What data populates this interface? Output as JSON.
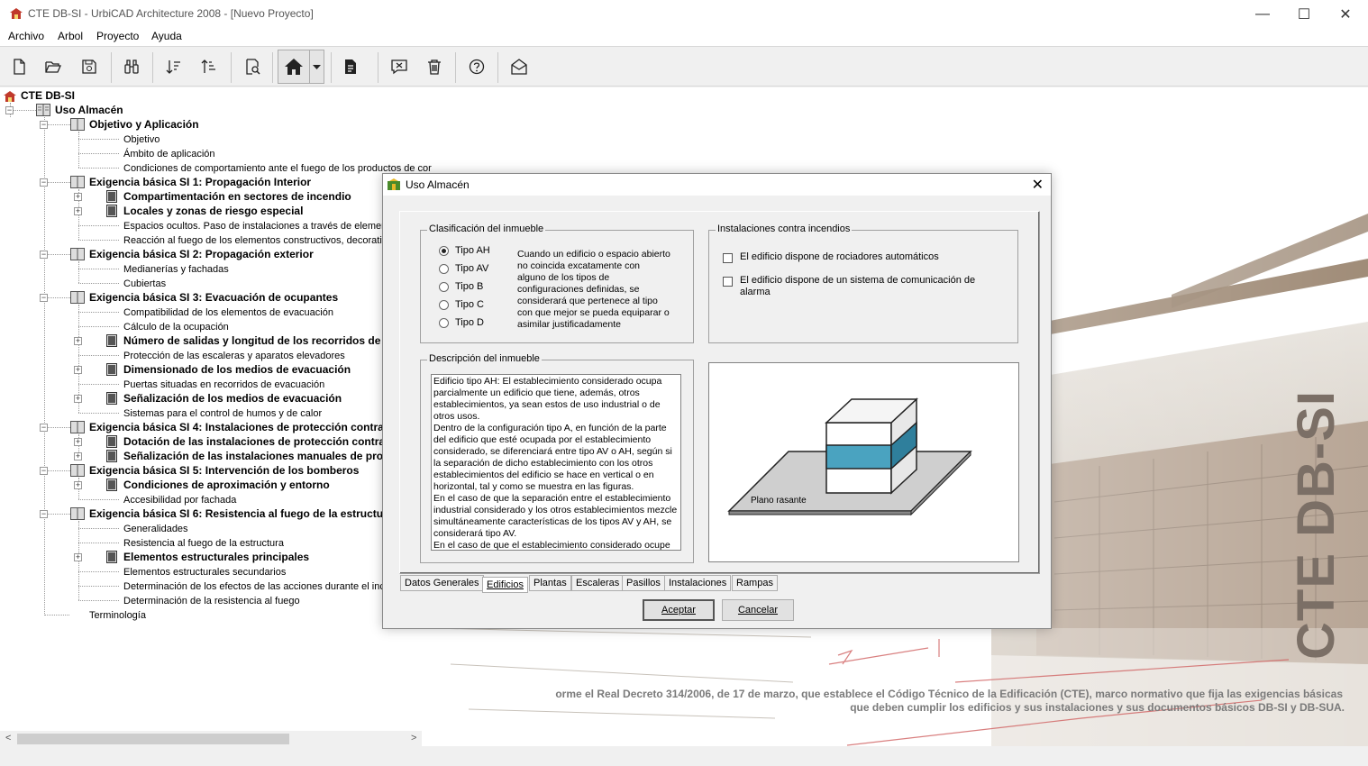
{
  "window": {
    "title": "CTE DB-SI - UrbiCAD Architecture 2008 - [Nuevo Proyecto]",
    "minimize": "—",
    "maximize": "☐",
    "close": "✕"
  },
  "menu": [
    "Archivo",
    "Arbol",
    "Proyecto",
    "Ayuda"
  ],
  "tree": {
    "root": "CTE DB-SI",
    "nodes": [
      {
        "label": "Uso Almacén"
      },
      {
        "label": "Objetivo y Aplicación"
      },
      {
        "label": "Objetivo"
      },
      {
        "label": "Ámbito de aplicación"
      },
      {
        "label": "Condiciones de comportamiento ante el fuego de los productos de cor"
      },
      {
        "label": "Exigencia básica SI 1: Propagación Interior"
      },
      {
        "label": "Compartimentación en sectores de incendio"
      },
      {
        "label": "Locales y zonas de riesgo especial"
      },
      {
        "label": "Espacios ocultos. Paso de instalaciones a través de elemento"
      },
      {
        "label": "Reacción al fuego de los elementos constructivos, decorativ"
      },
      {
        "label": "Exigencia básica SI 2: Propagación exterior"
      },
      {
        "label": "Medianerías y fachadas"
      },
      {
        "label": "Cubiertas"
      },
      {
        "label": "Exigencia básica SI 3: Evacuación de ocupantes"
      },
      {
        "label": "Compatibilidad de los elementos de evacuación"
      },
      {
        "label": "Cálculo de la ocupación"
      },
      {
        "label": "Número de salidas y longitud de los recorridos de e"
      },
      {
        "label": "Protección de las escaleras y aparatos elevadores"
      },
      {
        "label": "Dimensionado de los medios de evacuación"
      },
      {
        "label": "Puertas situadas en recorridos de evacuación"
      },
      {
        "label": "Señalización de los medios de evacuación"
      },
      {
        "label": "Sistemas para el control de humos y de calor"
      },
      {
        "label": "Exigencia básica SI 4: Instalaciones de protección contra"
      },
      {
        "label": "Dotación de las instalaciones de protección contra"
      },
      {
        "label": "Señalización de las instalaciones manuales de prot"
      },
      {
        "label": "Exigencia básica SI 5: Intervención de los bomberos"
      },
      {
        "label": "Condiciones de aproximación y entorno"
      },
      {
        "label": "Accesibilidad por fachada"
      },
      {
        "label": "Exigencia básica SI 6: Resistencia al fuego de la estructu"
      },
      {
        "label": "Generalidades"
      },
      {
        "label": "Resistencia al fuego de la estructura"
      },
      {
        "label": "Elementos estructurales principales"
      },
      {
        "label": "Elementos estructurales secundarios"
      },
      {
        "label": "Determinación de los efectos de las acciones durante el ince"
      },
      {
        "label": "Determinación de la resistencia al fuego"
      },
      {
        "label": "Terminología"
      }
    ]
  },
  "background": {
    "brand": "CTE DB-SI",
    "banner_line1": "orme el Real Decreto 314/2006, de 17 de marzo, que establece el Código Técnico de la Edificación (CTE), marco normativo que fija las exigencias básicas",
    "banner_line2": "que deben cumplir los edificios y sus instalaciones y sus documentos básicos DB-SI y DB-SUA."
  },
  "dialog": {
    "title": "Uso Almacén",
    "close": "✕",
    "clasificacion": {
      "label": "Clasificación del inmueble",
      "options": [
        "Tipo AH",
        "Tipo AV",
        "Tipo B",
        "Tipo C",
        "Tipo D"
      ],
      "selected": "Tipo AH",
      "note": "Cuando un edificio o espacio abierto no coincida excatamente con alguno de los tipos de configuraciones definidas, se considerará que pertenece al tipo con que mejor se pueda equiparar o asimilar justificadamente"
    },
    "instalaciones": {
      "label": "Instalaciones contra incendios",
      "checks": [
        "El edificio dispone de rociadores automáticos",
        "El edificio dispone de un sistema de comunicación de alarma"
      ]
    },
    "descripcion": {
      "label": "Descripción del inmueble",
      "text": "Edificio tipo AH: El establecimiento considerado ocupa parcialmente un edificio que tiene, además, otros establecimientos, ya sean estos de uso industrial o de otros usos.\nDentro de la configuración tipo A, en función de la parte del edificio que esté ocupada por el establecimiento considerado, se diferenciará entre tipo AV o AH, según si la separación de dicho establecimiento con los otros establecimientos del edificio se hace en vertical o en horizontal, tal y como se muestra en las figuras.\nEn el caso de que la separación entre el establecimiento industrial considerado y los otros establecimientos mezcle simultáneamente características de los tipos AV y AH, se considerará tipo AV.\nEn el caso de que el establecimiento considerado ocupe"
    },
    "figure": {
      "plane_label": "Plano rasante",
      "highlight_color": "#4aa3c0"
    },
    "tabs": [
      "Datos Generales",
      "Edificios",
      "Plantas",
      "Escaleras",
      "Pasillos",
      "Instalaciones",
      "Rampas"
    ],
    "active_tab": "Edificios",
    "accept": "Aceptar",
    "cancel": "Cancelar"
  },
  "scroll": {
    "left": "<",
    "right": ">"
  }
}
